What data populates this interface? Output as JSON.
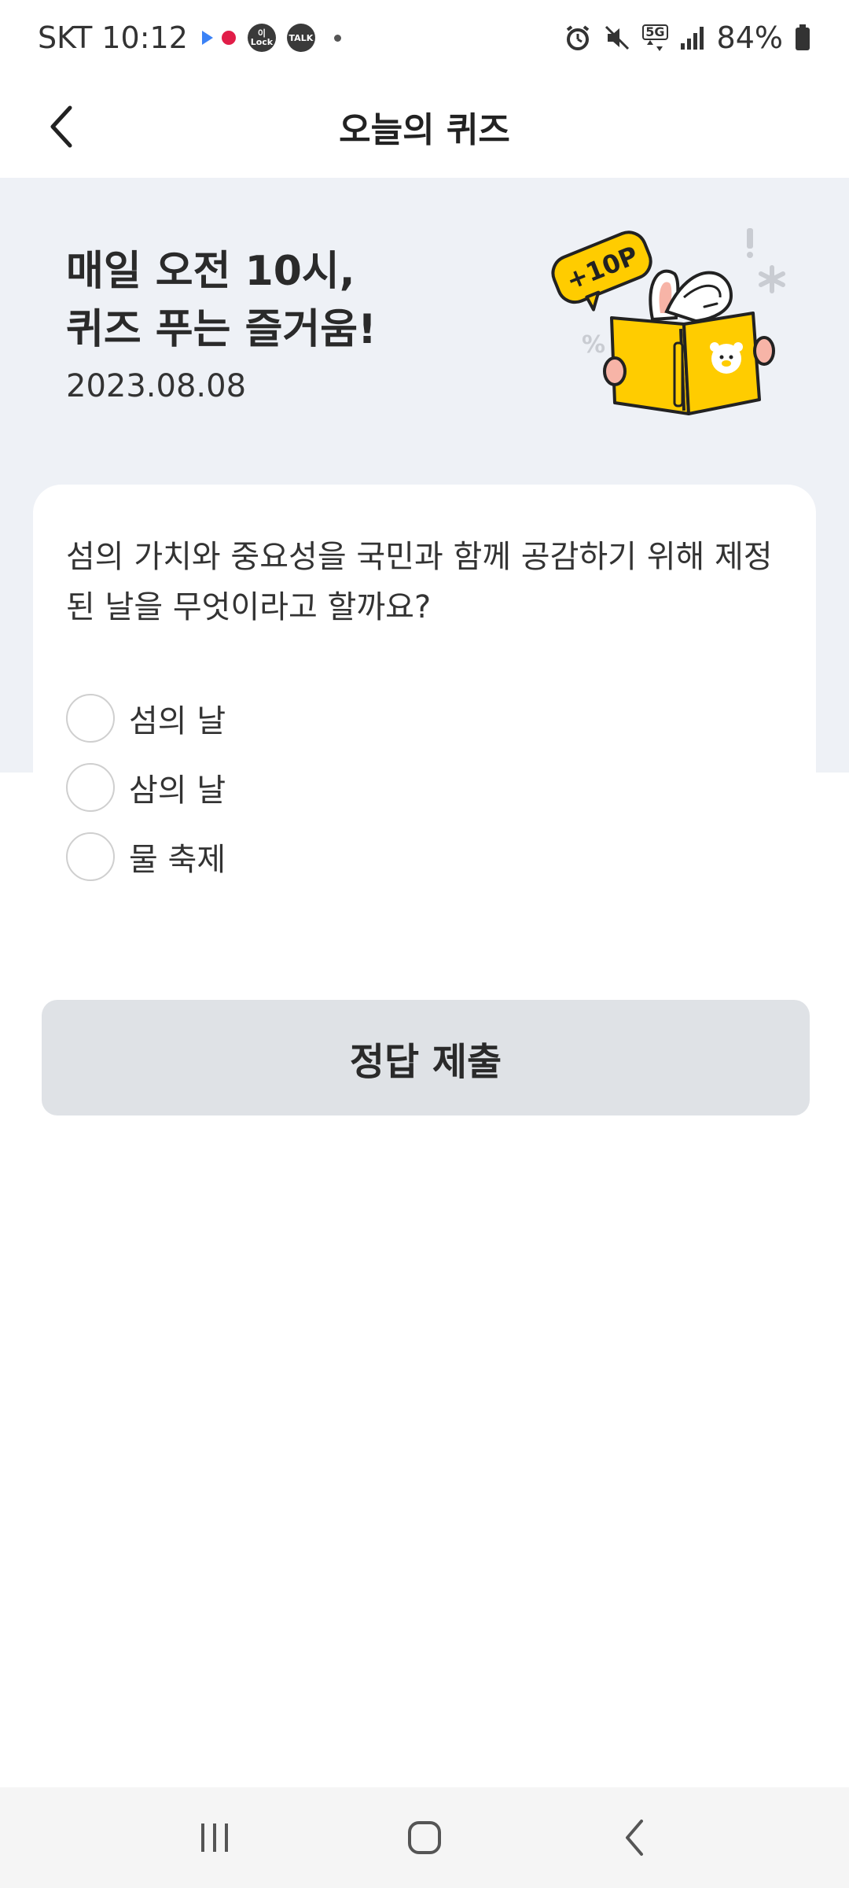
{
  "status_bar": {
    "carrier_time": "SKT 10:12",
    "notif_lock_label": "이 Lock",
    "notif_talk_label": "TALK",
    "network": "5G",
    "battery": "84%"
  },
  "header": {
    "title": "오늘의 퀴즈"
  },
  "banner": {
    "headline_line1": "매일 오전 10시,",
    "headline_line2": "퀴즈 푸는 즐거움!",
    "date": "2023.08.08",
    "badge": "+10P"
  },
  "quiz": {
    "question": "섬의 가치와 중요성을 국민과 함께 공감하기 위해 제정된 날을 무엇이라고 할까요?",
    "options": [
      {
        "label": "섬의 날"
      },
      {
        "label": "삼의 날"
      },
      {
        "label": "물 축제"
      }
    ]
  },
  "submit": {
    "label": "정답 제출"
  },
  "icons": {
    "back": "chevron-left-icon",
    "nav_recents": "recents-icon",
    "nav_home": "home-icon",
    "nav_back": "back-icon"
  },
  "colors": {
    "banner_bg": "#eef1f6",
    "book_yellow": "#ffcc00",
    "button_bg": "#dfe2e6"
  }
}
